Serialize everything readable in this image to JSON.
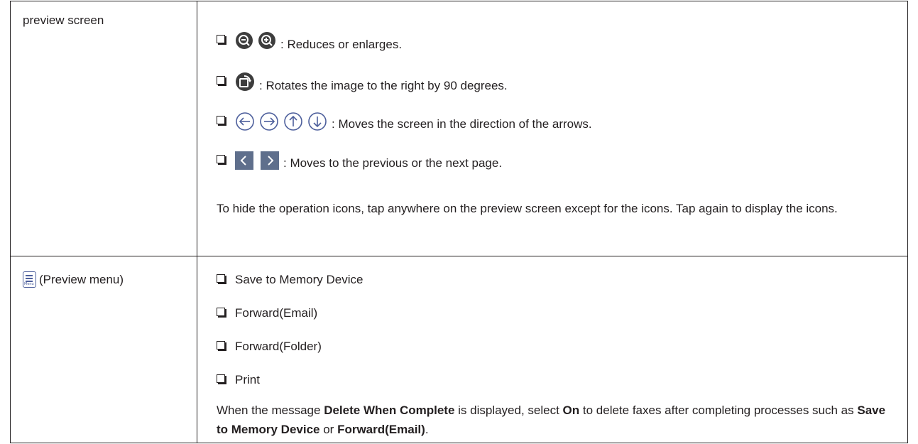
{
  "rows": [
    {
      "label": "preview screen",
      "items": [
        {
          "text": ": Reduces or enlarges.",
          "icons": [
            "zoom-out-icon",
            "zoom-in-icon"
          ]
        },
        {
          "text": ": Rotates the image to the right by 90 degrees.",
          "icons": [
            "rotate-right-icon"
          ]
        },
        {
          "text": ": Moves the screen in the direction of the arrows.",
          "icons": [
            "arrow-left-circle-icon",
            "arrow-right-circle-icon",
            "arrow-up-circle-icon",
            "arrow-down-circle-icon"
          ]
        },
        {
          "text": ": Moves to the previous or the next page.",
          "icons": [
            "previous-page-icon",
            "next-page-icon"
          ]
        }
      ],
      "note": "To hide the operation icons, tap anywhere on the preview screen except for the icons. Tap again to display the icons."
    },
    {
      "label": "(Preview menu)",
      "menu_icon_text": "Menu",
      "items": [
        "Save to Memory Device",
        "Forward(Email)",
        "Forward(Folder)",
        "Print"
      ],
      "note_parts": {
        "p1": "When the message ",
        "b1": "Delete When Complete",
        "p2": " is displayed, select ",
        "b2": "On",
        "p3": " to delete faxes after completing processes such as ",
        "b3": "Save to Memory Device",
        "p4": " or ",
        "b4": "Forward(Email)",
        "p5": "."
      }
    }
  ],
  "colors": {
    "text": "#231f20",
    "icon_dark": "#3d3d3d",
    "icon_blue": "#4d5f9c"
  }
}
